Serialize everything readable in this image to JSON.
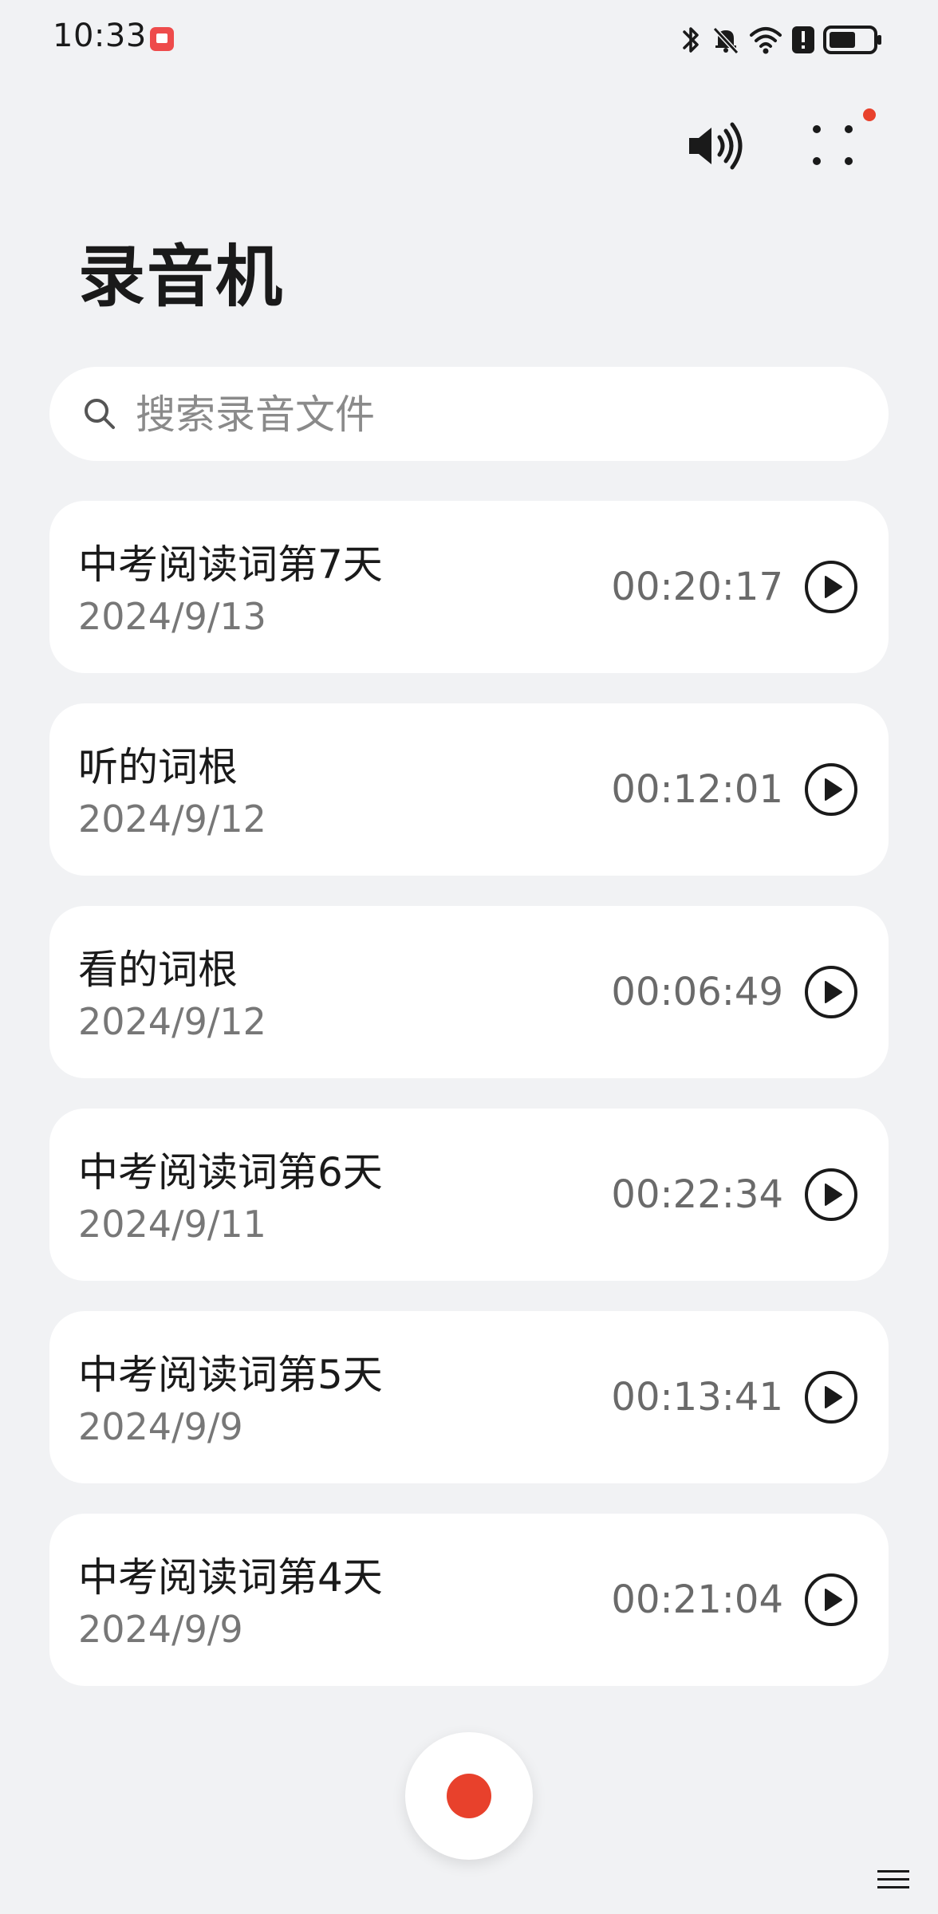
{
  "status_bar": {
    "time": "10:33"
  },
  "app": {
    "title": "录音机"
  },
  "search": {
    "placeholder": "搜索录音文件"
  },
  "recordings": [
    {
      "title": "中考阅读词第7天",
      "date": "2024/9/13",
      "duration": "00:20:17"
    },
    {
      "title": "听的词根",
      "date": "2024/9/12",
      "duration": "00:12:01"
    },
    {
      "title": "看的词根",
      "date": "2024/9/12",
      "duration": "00:06:49"
    },
    {
      "title": "中考阅读词第6天",
      "date": "2024/9/11",
      "duration": "00:22:34"
    },
    {
      "title": "中考阅读词第5天",
      "date": "2024/9/9",
      "duration": "00:13:41"
    },
    {
      "title": "中考阅读词第4天",
      "date": "2024/9/9",
      "duration": "00:21:04"
    }
  ],
  "colors": {
    "background": "#f1f2f4",
    "card": "#ffffff",
    "accent_red": "#e8412c",
    "text_primary": "#1a1a1a",
    "text_secondary": "#777777"
  },
  "icons": {
    "speaker": "speaker-icon",
    "more": "more-dots-icon",
    "search": "search-icon",
    "play": "play-icon",
    "record": "record-icon"
  }
}
